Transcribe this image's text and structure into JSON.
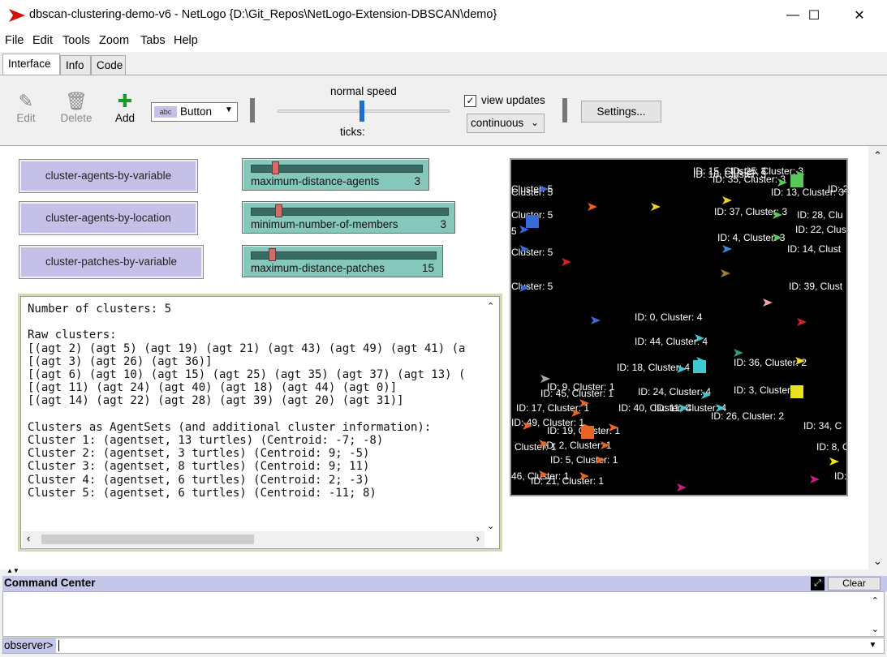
{
  "window": {
    "title": "dbscan-clustering-demo-v6 - NetLogo {D:\\Git_Repos\\NetLogo-Extension-DBSCAN\\demo}",
    "controls": {
      "minimize": "—",
      "maximize": "☐",
      "close": "✕"
    }
  },
  "menu": [
    "File",
    "Edit",
    "Tools",
    "Zoom",
    "Tabs",
    "Help"
  ],
  "tabs": [
    "Interface",
    "Info",
    "Code"
  ],
  "toolbar": {
    "edit_label": "Edit",
    "delete_label": "Delete",
    "add_label": "Add",
    "widget_type": "Button",
    "widget_type_icon": "abc",
    "speed_label": "normal speed",
    "speed_value": 0.5,
    "ticks_label": "ticks:",
    "view_updates_label": "view updates",
    "view_updates_checked": true,
    "update_mode": "continuous",
    "settings_label": "Settings..."
  },
  "buttons": [
    {
      "label": "cluster-agents-by-variable"
    },
    {
      "label": "cluster-agents-by-location"
    },
    {
      "label": "cluster-patches-by-variable"
    }
  ],
  "sliders": [
    {
      "label": "maximum-distance-agents",
      "value": "3"
    },
    {
      "label": "minimum-number-of-members",
      "value": "3"
    },
    {
      "label": "maximum-distance-patches",
      "value": "15"
    }
  ],
  "output": {
    "lines": [
      "Number of clusters: 5",
      "",
      "Raw clusters:",
      "[(agt 2) (agt 5) (agt 19) (agt 21) (agt 43) (agt 49) (agt 41) (a",
      "[(agt 3) (agt 26) (agt 36)]",
      "[(agt 6) (agt 10) (agt 15) (agt 25) (agt 35) (agt 37) (agt 13) (",
      "[(agt 11) (agt 24) (agt 40) (agt 18) (agt 44) (agt 0)]",
      "[(agt 14) (agt 22) (agt 28) (agt 39) (agt 20) (agt 31)]",
      "",
      "Clusters as AgentSets (and additional cluster information):",
      "Cluster 1: (agentset, 13 turtles) (Centroid: -7; -8)",
      "Cluster 2: (agentset, 3 turtles) (Centroid: 9; -5)",
      "Cluster 3: (agentset, 8 turtles) (Centroid: 9; 11)",
      "Cluster 4: (agentset, 6 turtles) (Centroid: 2; -3)",
      "Cluster 5: (agentset, 6 turtles) (Centroid: -11; 8)"
    ]
  },
  "view": {
    "labels": [
      "ID: 15, Cluster: 3",
      "ID: 10, Cluster: 3",
      "ID: 25, Cluster: 3",
      "ID: 35, Cluster: 3",
      "ID: 13, Cluster: 3",
      "ID: 20, C",
      "Cluster: 5",
      "Cluster: 5",
      "ID: 37, Cluster: 3",
      "ID: 28, Clu",
      "Cluster: 5",
      "ID: 22, Cluste",
      "5",
      "ID: 4, Cluster: 3",
      "Cluster: 5",
      "ID: 14, Clust",
      "Cluster: 5",
      "ID: 39, Clust",
      "ID: 0, Cluster: 4",
      "ID: 44, Cluster: 4",
      "ID: 36, Cluster: 2",
      "ID: 18, Cluster: 4",
      "ID: 9, Cluster: 1",
      "ID: 45, Cluster: 1",
      "ID: 3, Cluster: 2",
      "ID: 24, Cluster: 4",
      "ID: 17, Cluster: 1",
      "ID: 40, Cluster: 4",
      "ID: 11, Cluster: 4",
      "ID: 26, Cluster: 2",
      "ID: 49, Cluster: 1",
      "ID: 19, Cluster: 1",
      "ID: 34, C",
      "ID: 2, Cluster: 1",
      "Cluster: 1",
      "ID: 8, C",
      "ID: 5, Cluster: 1",
      "46, Cluster: 1",
      "ID: 21, Cluster: 1",
      "ID: 4"
    ]
  },
  "command_center": {
    "title": "Command Center",
    "clear_label": "Clear",
    "prompt": "observer>",
    "input_value": ""
  },
  "colors": {
    "button_bg": "#c4c0e8",
    "slider_bg": "#86c7bb",
    "command_header_bg": "#c4c6ea",
    "view_bg": "#000000"
  }
}
